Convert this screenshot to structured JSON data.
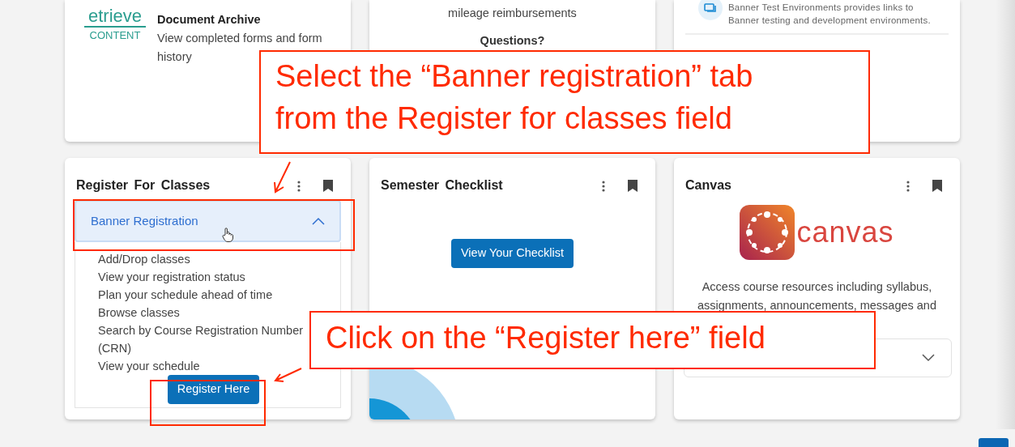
{
  "top_cards": [
    {
      "kind": "archive",
      "logo_text": "etrieve",
      "logo_sub": "CONTENT",
      "title": "Document Archive",
      "description": "View completed forms and form history"
    },
    {
      "kind": "text",
      "lines": [
        "mileage reimbursements"
      ],
      "heading": "Questions?"
    },
    {
      "kind": "info",
      "description": "Banner Test Environments provides links to Banner testing and development environments."
    }
  ],
  "cards": [
    {
      "kind": "register",
      "title": "Register For Classes",
      "accordion": {
        "label": "Banner Registration",
        "expanded": true,
        "items": [
          "Add/Drop classes",
          "View your registration status",
          "Plan your schedule ahead of time",
          "Browse classes",
          "Search by Course Registration Number (CRN)",
          "View your schedule"
        ]
      },
      "button": "Register Here"
    },
    {
      "kind": "checklist",
      "title": "Semester Checklist",
      "button": "View Your Checklist"
    },
    {
      "kind": "canvas",
      "title": "Canvas",
      "logo_text": "canvas",
      "description": "Access course resources including syllabus, assignments, announcements, messages and",
      "accordion": {
        "expanded": false
      }
    }
  ],
  "annotations": [
    {
      "kind": "callout",
      "lines": [
        "Select the “Banner registration” tab",
        "from the Register for classes field"
      ]
    },
    {
      "kind": "arrow"
    },
    {
      "kind": "frame"
    },
    {
      "kind": "callout",
      "lines": [
        "Click on the “Register here” field"
      ]
    },
    {
      "kind": "arrow"
    },
    {
      "kind": "frame"
    }
  ]
}
